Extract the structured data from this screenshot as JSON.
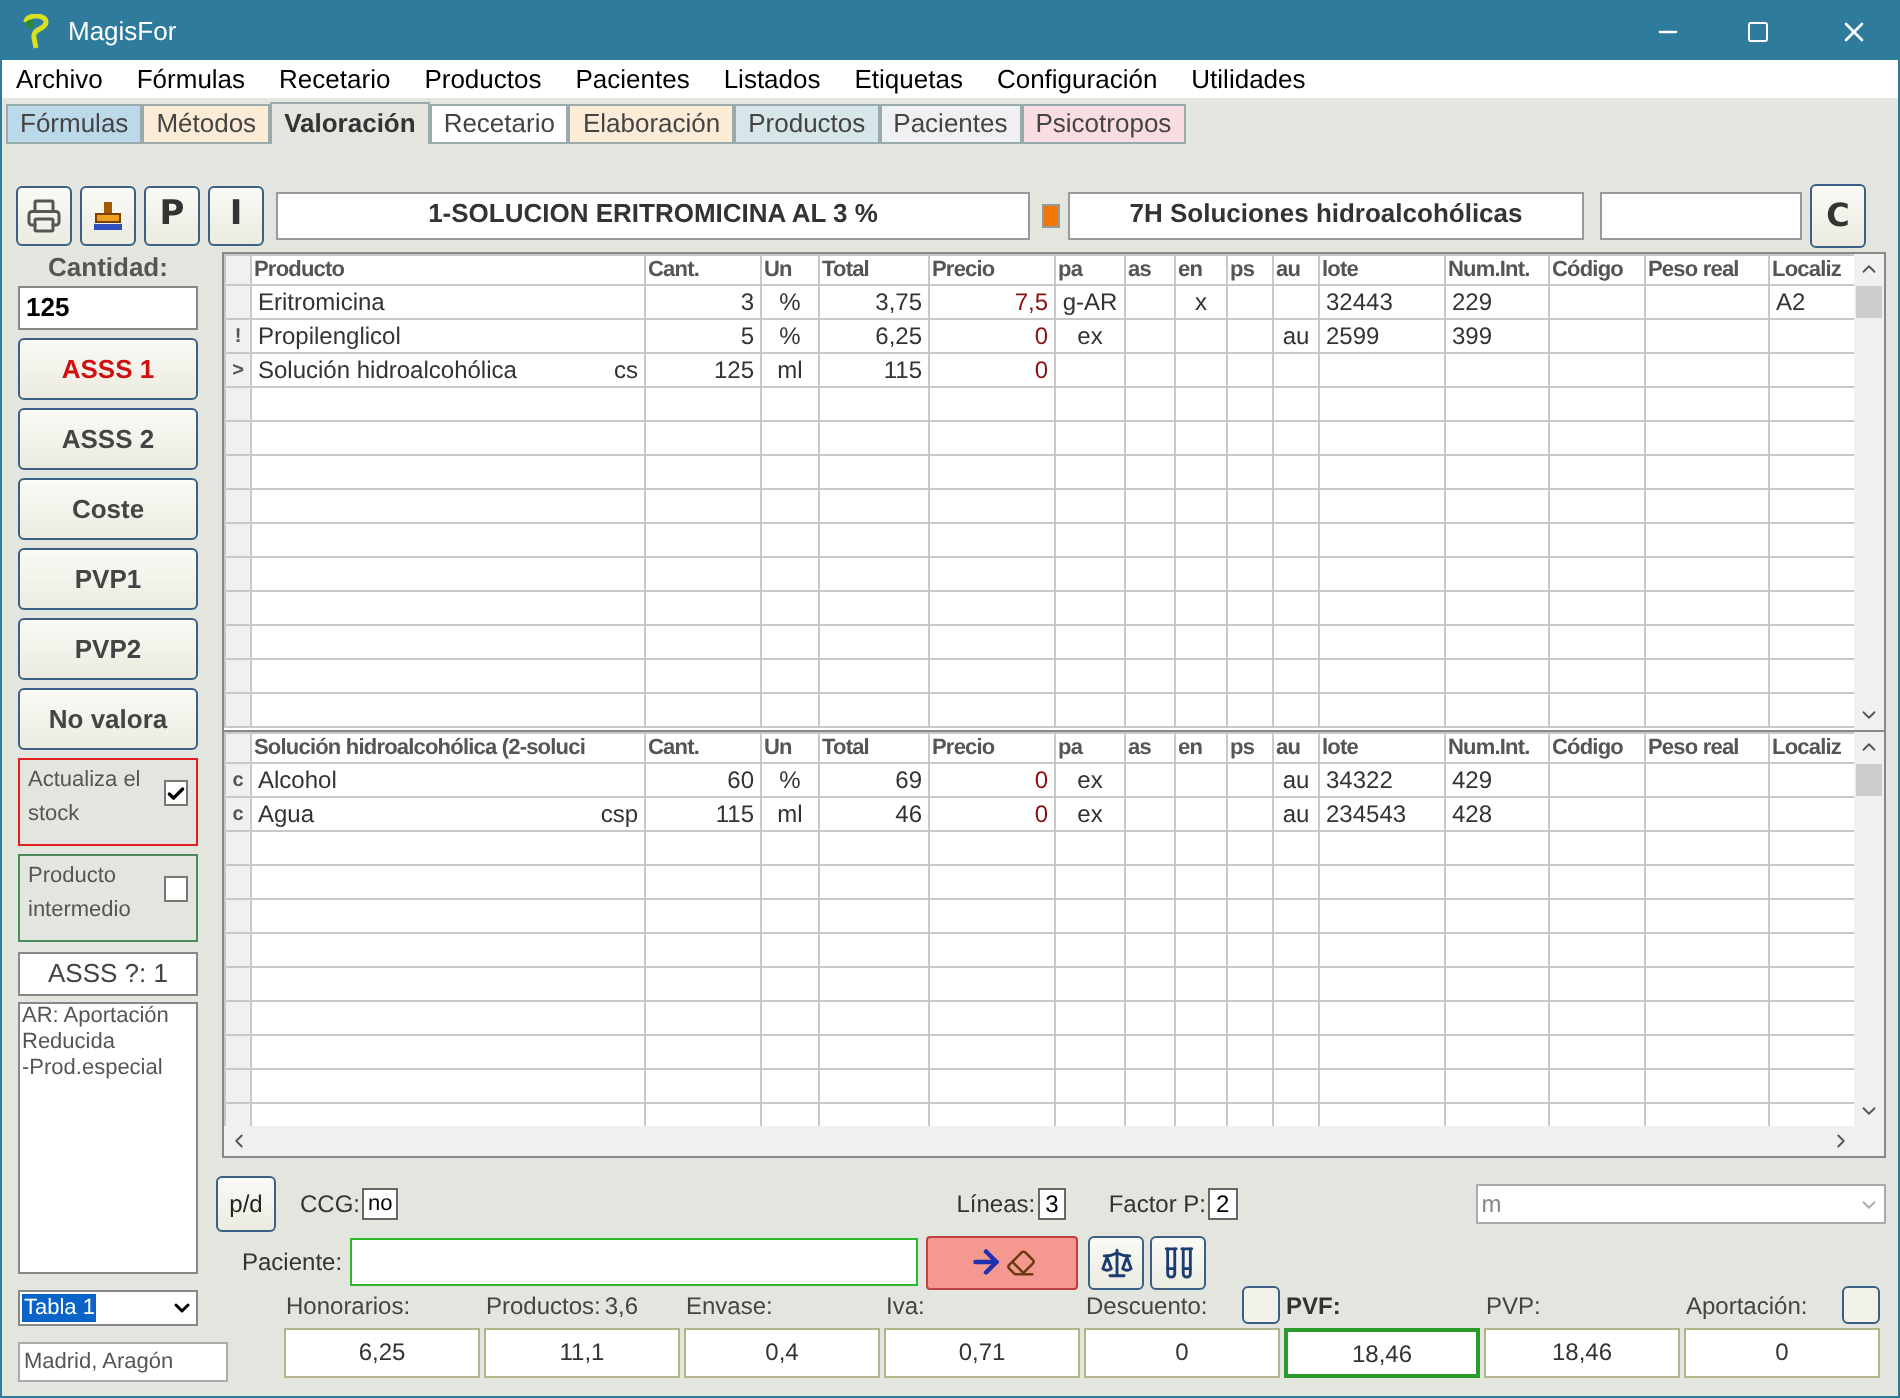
{
  "window": {
    "title": "MagisFor"
  },
  "menu": [
    "Archivo",
    "Fórmulas",
    "Recetario",
    "Productos",
    "Pacientes",
    "Listados",
    "Etiquetas",
    "Configuración",
    "Utilidades"
  ],
  "tabs": [
    {
      "label": "Fórmulas",
      "selected": false,
      "color": "#bcd9ea"
    },
    {
      "label": "Métodos",
      "selected": false,
      "color": "#fcebd6"
    },
    {
      "label": "Valoración",
      "selected": true,
      "color": "#e2e6df"
    },
    {
      "label": "Recetario",
      "selected": false,
      "color": "#ffffff"
    },
    {
      "label": "Elaboración",
      "selected": false,
      "color": "#fcebd6"
    },
    {
      "label": "Productos",
      "selected": false,
      "color": "#d6e6e9"
    },
    {
      "label": "Pacientes",
      "selected": false,
      "color": "#eef0f1"
    },
    {
      "label": "Psicotropos",
      "selected": false,
      "color": "#f9dde3"
    }
  ],
  "toolbar": {
    "letter_buttons": [
      "P",
      "I"
    ],
    "formula": "1-SOLUCION ERITROMICINA AL 3 %",
    "group": "7H Soluciones hidroalcohólicas",
    "right_button": "C"
  },
  "sidebar": {
    "quantity_label": "Cantidad:",
    "quantity": "125",
    "buttons": [
      {
        "label": "ASSS 1",
        "highlighted": true
      },
      {
        "label": "ASSS 2",
        "highlighted": false
      },
      {
        "label": "Coste",
        "highlighted": false
      },
      {
        "label": "PVP1",
        "highlighted": false
      },
      {
        "label": "PVP2",
        "highlighted": false
      },
      {
        "label": "No valora",
        "highlighted": false
      }
    ],
    "options": [
      {
        "label": "Actualiza el stock",
        "checked": true,
        "color": "#e02020"
      },
      {
        "label": "Producto intermedio",
        "checked": false,
        "color": "#4a8a5a"
      }
    ],
    "asss_status": "ASSS ?: 1",
    "notes": [
      "AR: Aportación Reducida",
      "-Prod.especial"
    ],
    "table_select": "Tabla 1",
    "region": "Madrid, Aragón"
  },
  "formula_columns": [
    "Producto",
    "Cant.",
    "Un",
    "Total",
    "Precio",
    "pa",
    "as",
    "en",
    "ps",
    "au",
    "lote",
    "Num.Int.",
    "Código",
    "Peso real",
    "Localiz"
  ],
  "formula_rows": [
    {
      "product": "Eritromicina",
      "cant": "3",
      "un": "%",
      "total": "3,75",
      "precio": "7,5",
      "pa": "g-AR",
      "en": "x",
      "lote": "32443",
      "num_int": "229",
      "localiz": "A2"
    },
    {
      "marker": "!",
      "product": "Propilenglicol",
      "cant": "5",
      "un": "%",
      "total": "6,25",
      "precio": "0",
      "pa": "ex",
      "au": "au",
      "lote": "2599",
      "num_int": "399"
    },
    {
      "marker": ">",
      "product": "Solución hidroalcohólica",
      "note": "cs",
      "cant": "125",
      "un": "ml",
      "total": "115",
      "precio": "0"
    }
  ],
  "sub_columns": [
    "Solución hidroalcohólica (2-soluci",
    "Cant.",
    "Un",
    "Total",
    "Precio",
    "pa",
    "as",
    "en",
    "ps",
    "au",
    "lote",
    "Num.Int.",
    "Código",
    "Peso real",
    "Localiz"
  ],
  "sub_rows": [
    {
      "marker": "c",
      "product": "Alcohol",
      "cant": "60",
      "un": "%",
      "total": "69",
      "precio": "0",
      "pa": "ex",
      "au": "au",
      "lote": "34322",
      "num_int": "429"
    },
    {
      "marker": "c",
      "product": "Agua",
      "note": "csp",
      "cant": "115",
      "un": "ml",
      "total": "46",
      "precio": "0",
      "pa": "ex",
      "au": "au",
      "lote": "234543",
      "num_int": "428"
    }
  ],
  "footer": {
    "pd_button": "p/d",
    "ccg_label": "CCG:",
    "ccg": "no",
    "lines_label": "Líneas:",
    "lines": "3",
    "factor_label": "Factor P:",
    "factor": "2",
    "unit_select": "m",
    "patient_label": "Paciente:",
    "totals": [
      {
        "label": "Honorarios:",
        "value": "6,25",
        "highlighted": false
      },
      {
        "label": "Productos:",
        "extra": "3,6",
        "value": "11,1",
        "highlighted": false
      },
      {
        "label": "Envase:",
        "value": "0,4",
        "highlighted": false
      },
      {
        "label": "Iva:",
        "value": "0,71",
        "highlighted": false
      },
      {
        "label": "Descuento:",
        "value": "0",
        "highlighted": false,
        "kind": "toggle"
      },
      {
        "label": "PVF:",
        "value": "18,46",
        "highlighted": true
      },
      {
        "label": "PVP:",
        "value": "18,46",
        "highlighted": false
      },
      {
        "label": "Aportación:",
        "value": "0",
        "highlighted": false,
        "kind": "toggle"
      }
    ]
  }
}
